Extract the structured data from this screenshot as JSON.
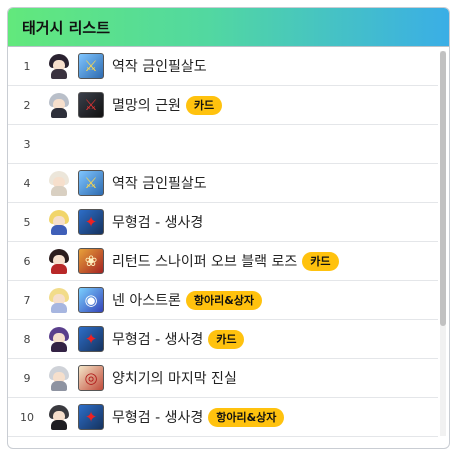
{
  "header": {
    "title": "태거시 리스트"
  },
  "rows": [
    {
      "num": "1",
      "label": "역작 금인필살도",
      "badge": "",
      "avatar": "dark-hair-character",
      "skill": "golden-sword-skill-icon"
    },
    {
      "num": "2",
      "label": "멸망의 근원",
      "badge": "카드",
      "avatar": "silver-hair-character",
      "skill": "dark-slash-skill-icon"
    },
    {
      "num": "3",
      "label": "",
      "badge": "",
      "avatar": "",
      "skill": ""
    },
    {
      "num": "4",
      "label": "역작 금인필살도",
      "badge": "",
      "avatar": "white-hair-character",
      "skill": "golden-sword-skill-icon"
    },
    {
      "num": "5",
      "label": "무형검 - 생사경",
      "badge": "",
      "avatar": "blonde-character",
      "skill": "red-blade-skill-icon"
    },
    {
      "num": "6",
      "label": "리턴드 스나이퍼 오브 블랙 로즈",
      "badge": "카드",
      "avatar": "red-hat-character",
      "skill": "rose-sniper-skill-icon"
    },
    {
      "num": "7",
      "label": "넨 아스트론",
      "badge": "항아리&상자",
      "avatar": "blonde-mage-character",
      "skill": "blue-orb-skill-icon"
    },
    {
      "num": "8",
      "label": "무형검 - 생사경",
      "badge": "카드",
      "avatar": "purple-hair-character",
      "skill": "red-blade-skill-icon"
    },
    {
      "num": "9",
      "label": "양치기의 마지막 진실",
      "badge": "",
      "avatar": "grey-hair-character",
      "skill": "red-target-skill-icon"
    },
    {
      "num": "10",
      "label": "무형검 - 생사경",
      "badge": "항아리&상자",
      "avatar": "dark-armor-character",
      "skill": "red-blade-skill-icon"
    }
  ],
  "colors": {
    "badge": "#ffc20e",
    "header_start": "#62e87c",
    "header_end": "#3aaee6"
  }
}
